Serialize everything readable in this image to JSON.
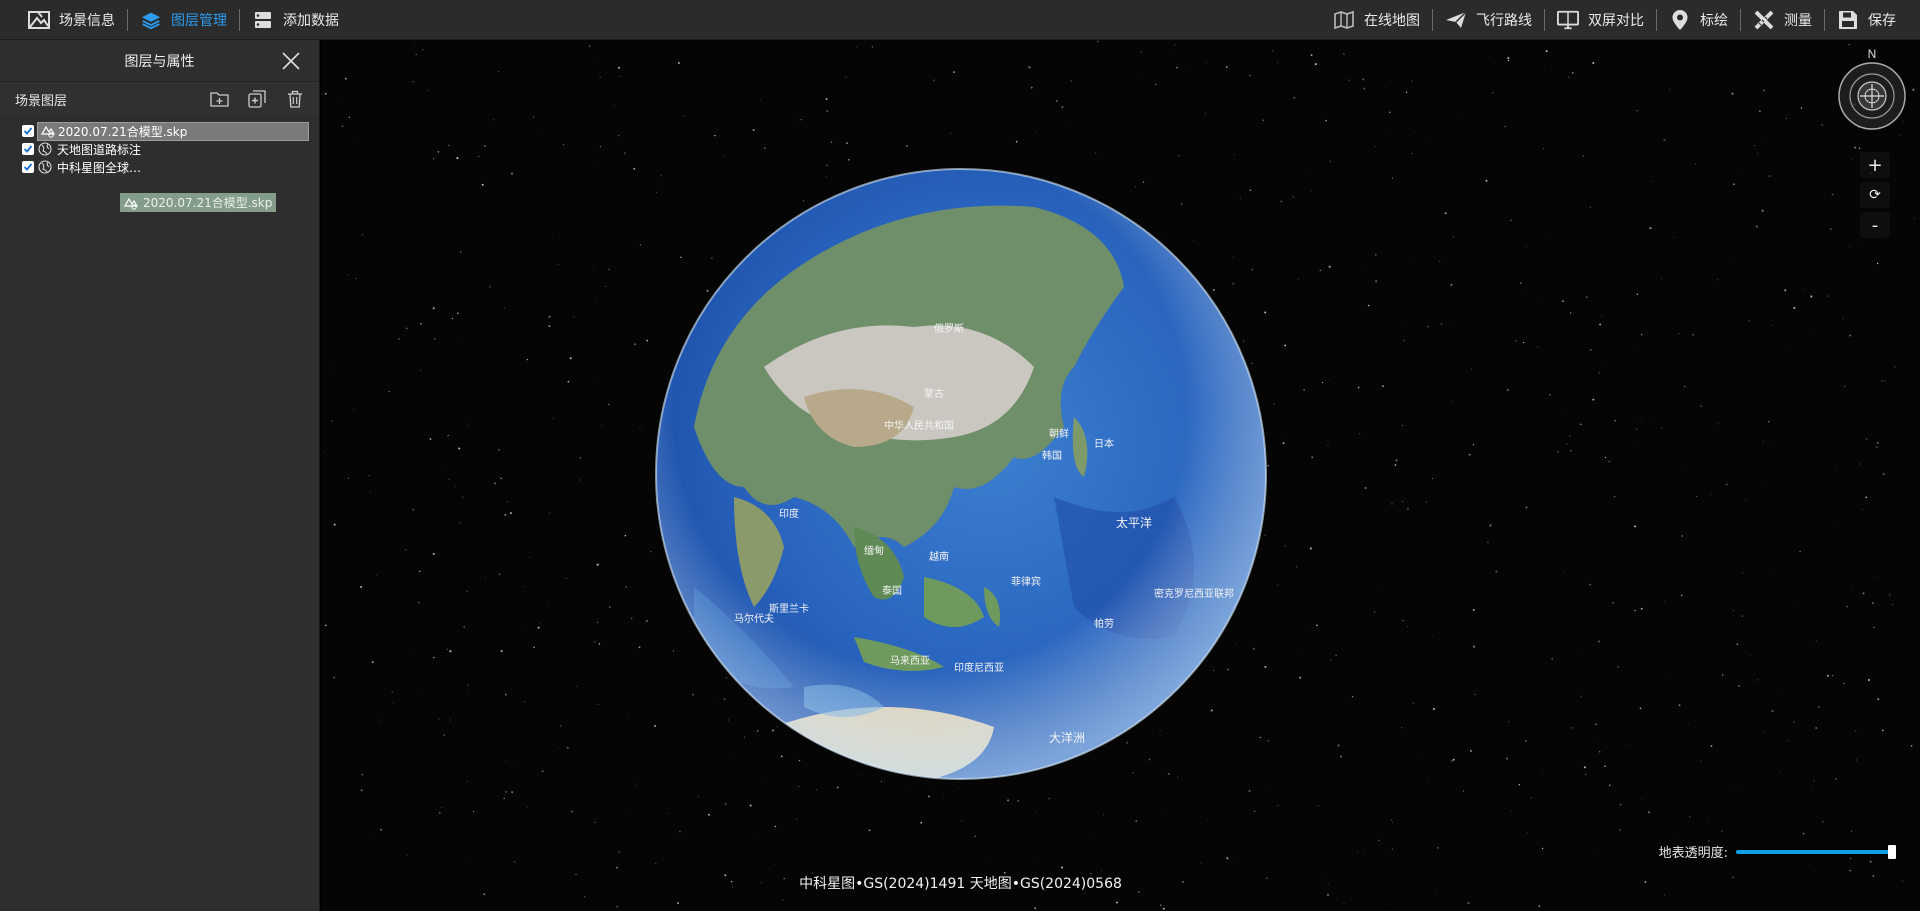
{
  "toolbar": {
    "left": [
      {
        "label": "场景信息",
        "icon": "scene-info-icon",
        "active": false
      },
      {
        "label": "图层管理",
        "icon": "layers-icon",
        "active": true
      },
      {
        "label": "添加数据",
        "icon": "add-data-icon",
        "active": false
      }
    ],
    "right": [
      {
        "label": "在线地图",
        "icon": "online-map-icon"
      },
      {
        "label": "飞行路线",
        "icon": "paper-plane-icon"
      },
      {
        "label": "双屏对比",
        "icon": "monitor-icon"
      },
      {
        "label": "标绘",
        "icon": "map-pin-icon"
      },
      {
        "label": "测量",
        "icon": "measure-icon"
      },
      {
        "label": "保存",
        "icon": "save-icon"
      }
    ]
  },
  "panel": {
    "title": "图层与属性",
    "section_title": "场景图层",
    "layers": [
      {
        "name": "2020.07.21合模型.skp",
        "checked": true,
        "icon": "model-icon",
        "selected": true
      },
      {
        "name": "天地图道路标注",
        "checked": true,
        "icon": "globe-layer-icon",
        "selected": false
      },
      {
        "name": "中科星图全球…",
        "checked": true,
        "icon": "globe-layer-icon",
        "selected": false
      }
    ],
    "drag_ghost": "2020.07.21合模型.skp"
  },
  "map": {
    "compass_label": "N",
    "zoom_in": "+",
    "reset": "⟳",
    "zoom_out": "-",
    "attribution": "中科星图•GS(2024)1491 天地图•GS(2024)0568",
    "opacity_label": "地表透明度:",
    "opacity_value": 1.0,
    "labels": [
      "中华人民共和国",
      "蒙古",
      "俄罗斯",
      "日本",
      "朝鲜",
      "韩国",
      "印度",
      "缅甸",
      "泰国",
      "越南",
      "菲律宾",
      "马来西亚",
      "印度尼西亚",
      "斯里兰卡",
      "马尔代夫",
      "太平洋",
      "帕劳",
      "密克罗尼西亚联邦",
      "大洋洲"
    ]
  }
}
